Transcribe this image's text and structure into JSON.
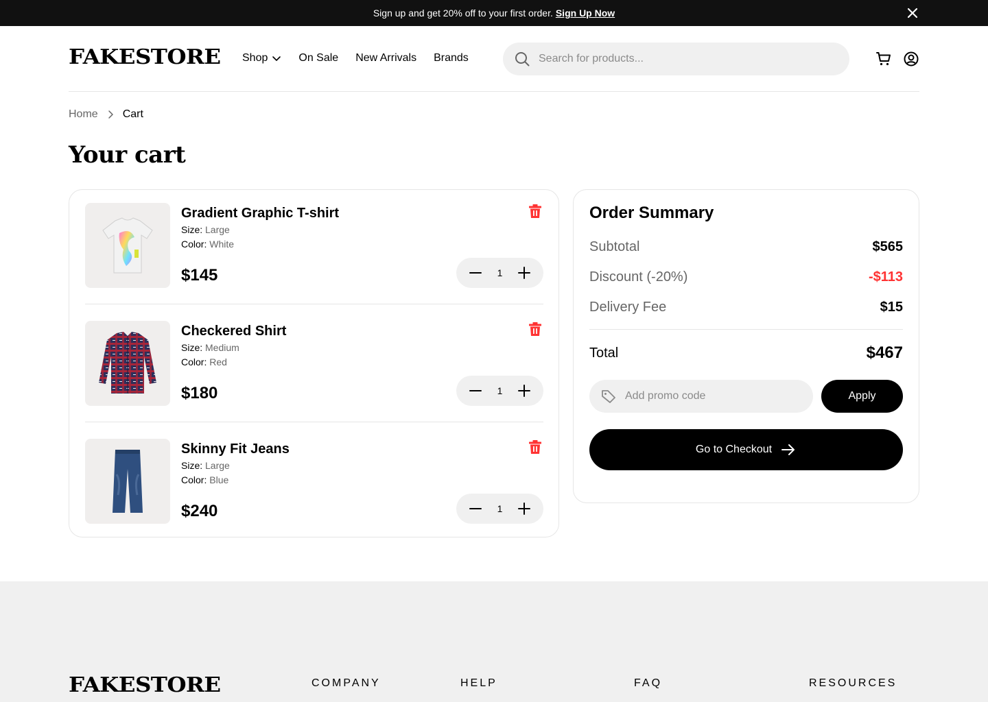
{
  "banner": {
    "message": "Sign up and get 20% off to your first order.",
    "link_label": "Sign Up Now"
  },
  "header": {
    "logo": "FAKESTORE",
    "nav": [
      "Shop",
      "On Sale",
      "New Arrivals",
      "Brands"
    ],
    "search_placeholder": "Search for products..."
  },
  "breadcrumb": {
    "home": "Home",
    "current": "Cart"
  },
  "page_title": "Your cart",
  "cart": {
    "size_label": "Size:",
    "color_label": "Color:",
    "items": [
      {
        "name": "Gradient Graphic T-shirt",
        "size": "Large",
        "color": "White",
        "price": "$145",
        "qty": "1",
        "thumb_icon": "tshirt-icon"
      },
      {
        "name": "Checkered Shirt",
        "size": "Medium",
        "color": "Red",
        "price": "$180",
        "qty": "1",
        "thumb_icon": "shirt-icon"
      },
      {
        "name": "Skinny Fit Jeans",
        "size": "Large",
        "color": "Blue",
        "price": "$240",
        "qty": "1",
        "thumb_icon": "jeans-icon"
      }
    ]
  },
  "summary": {
    "title": "Order Summary",
    "subtotal_label": "Subtotal",
    "subtotal": "$565",
    "discount_label": "Discount (-20%)",
    "discount": "-$113",
    "delivery_label": "Delivery Fee",
    "delivery": "$15",
    "total_label": "Total",
    "total": "$467",
    "promo_placeholder": "Add promo code",
    "apply_label": "Apply",
    "checkout_label": "Go to Checkout"
  },
  "footer": {
    "logo": "FAKESTORE",
    "columns": [
      "COMPANY",
      "HELP",
      "FAQ",
      "RESOURCES"
    ]
  },
  "colors": {
    "accent": "#000000",
    "discount": "#ff3333",
    "trash": "#ff3333",
    "surface": "#f0f0f0"
  }
}
